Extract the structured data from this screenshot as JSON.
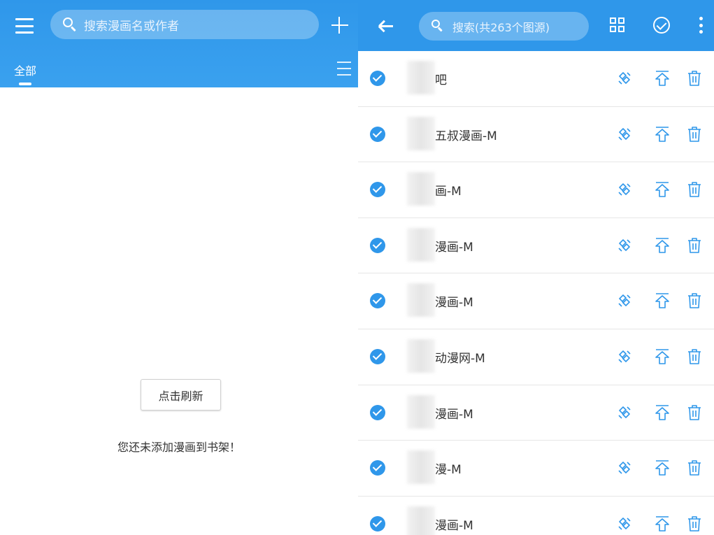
{
  "left": {
    "search_placeholder": "搜索漫画名或作者",
    "tab_all": "全部",
    "refresh_label": "点击刷新",
    "empty_message": "您还未添加漫画到书架！"
  },
  "right": {
    "search_placeholder": "搜索(共263个图源)",
    "sources": [
      {
        "name": "吧",
        "checked": true
      },
      {
        "name": "五叔漫画-M",
        "checked": true
      },
      {
        "name": "画-M",
        "checked": true
      },
      {
        "name": "漫画-M",
        "checked": true
      },
      {
        "name": "漫画-M",
        "checked": true
      },
      {
        "name": "动漫网-M",
        "checked": true
      },
      {
        "name": "漫画-M",
        "checked": true
      },
      {
        "name": "漫-M",
        "checked": true
      },
      {
        "name": "漫画-M",
        "checked": true
      }
    ]
  },
  "icons": {
    "left_menu": "menu-icon",
    "left_search": "search-icon",
    "left_add": "plus-icon",
    "left_tab_list": "list-icon",
    "right_back": "arrow-back-icon",
    "right_search": "search-icon",
    "right_grid": "grid-icon",
    "right_check_all": "check-circle-icon",
    "right_more": "more-vert-icon",
    "row_check": "check-circle-filled-icon",
    "row_edit": "edit-icon",
    "row_top": "arrow-up-icon",
    "row_delete": "trash-icon"
  },
  "colors": {
    "primary": "#2f97ea",
    "text": "#333333",
    "divider": "#e6e6e6"
  }
}
